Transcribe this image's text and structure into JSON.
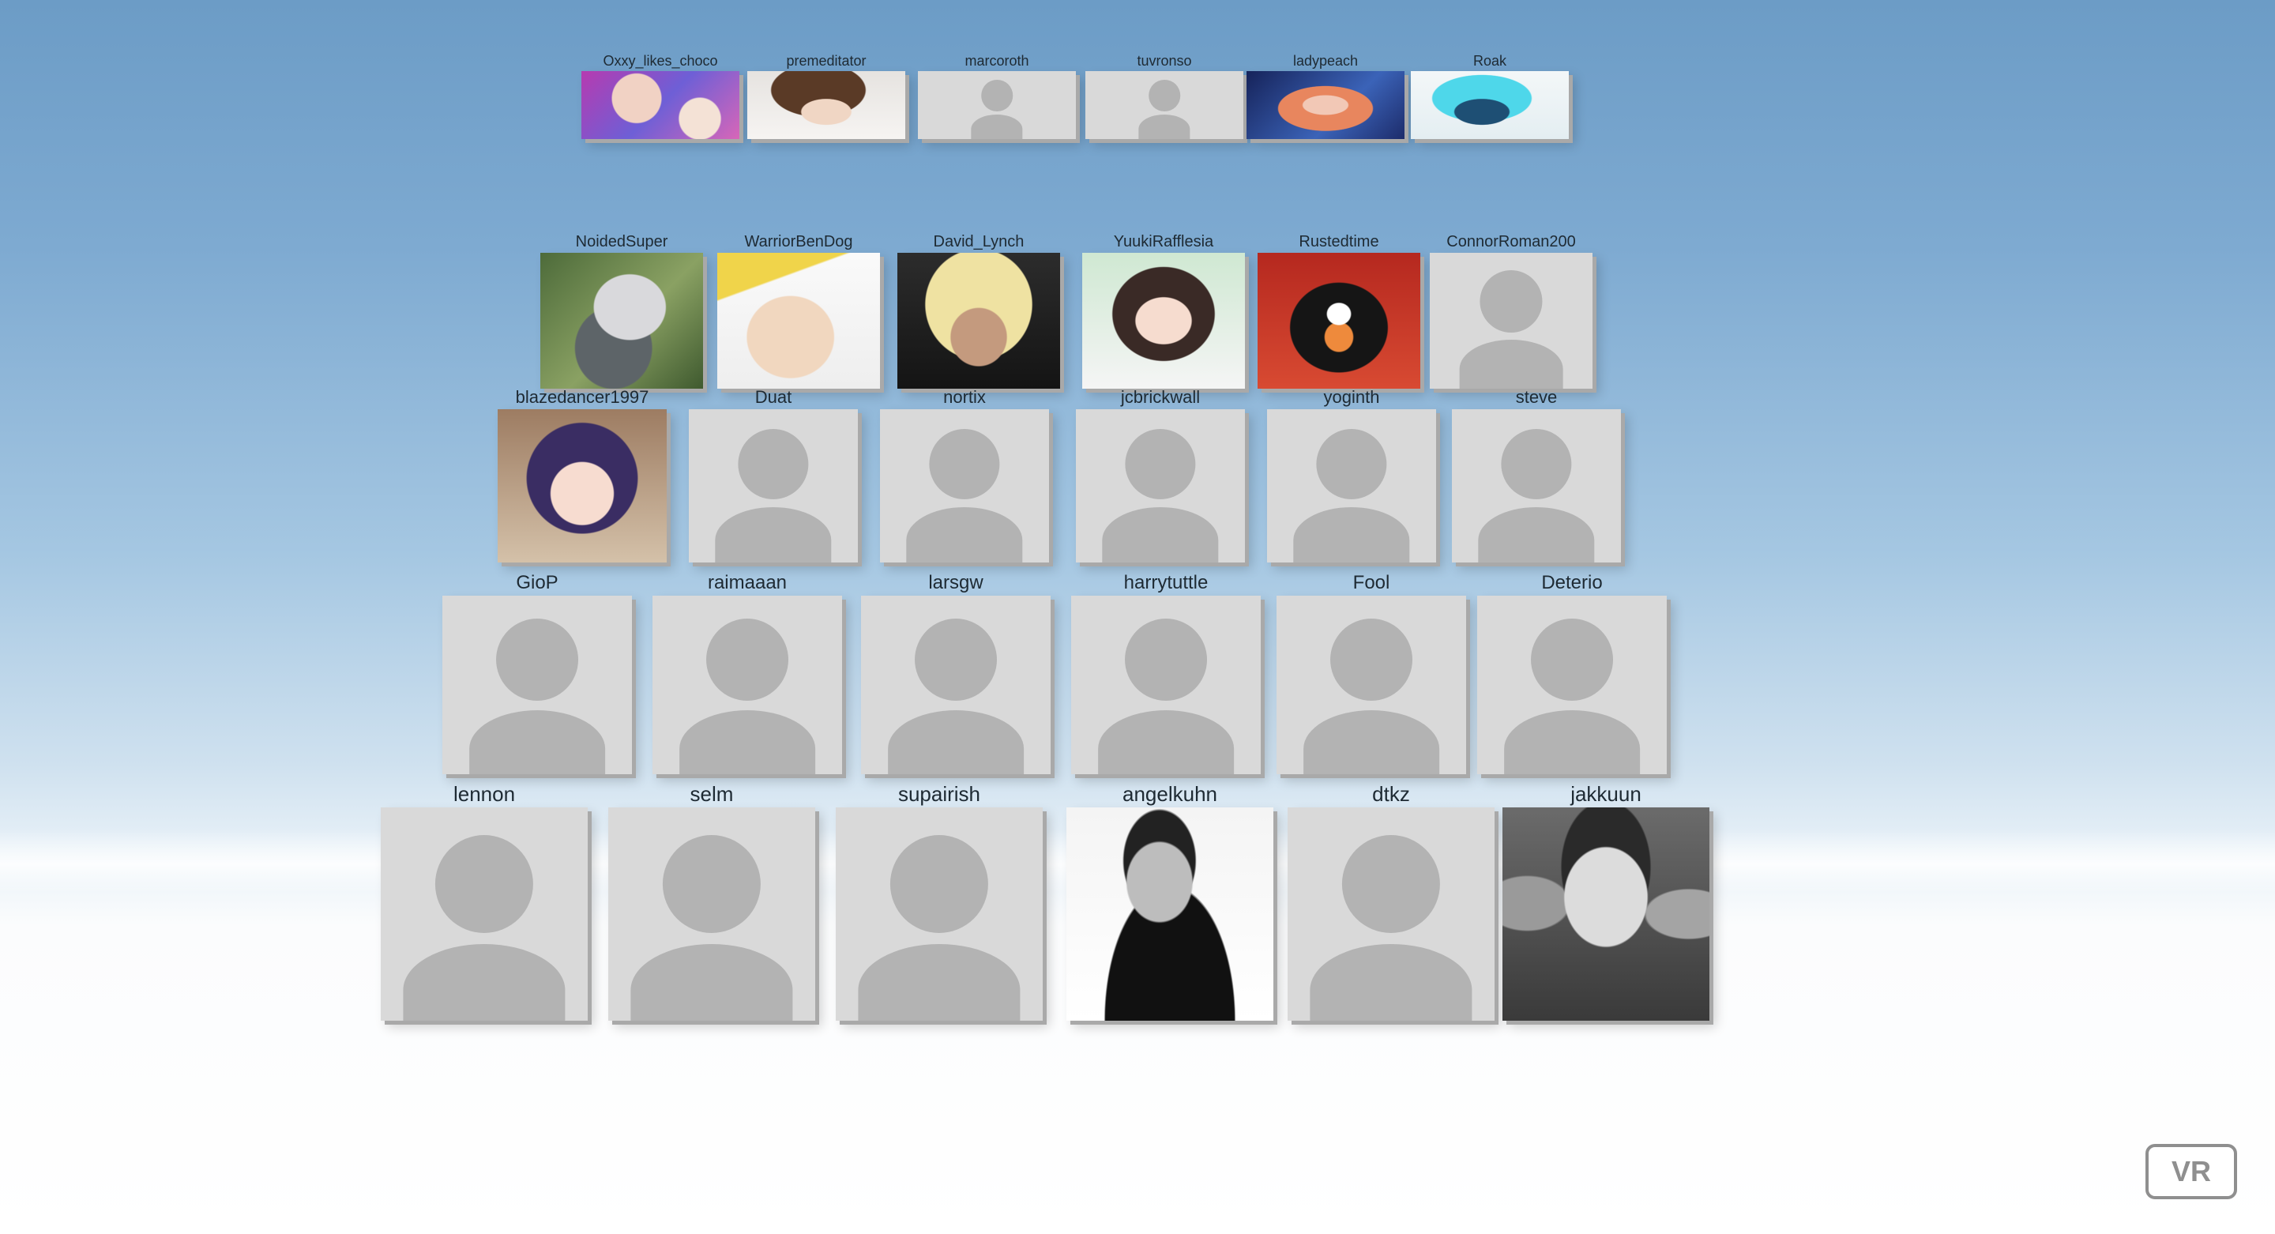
{
  "scene": {
    "sky_top": "#6c9cc6",
    "floor": "#ffffff",
    "tile_color": "#d9d9d9",
    "placeholder_color": "#b3b3b3"
  },
  "rows": [
    {
      "users": [
        {
          "name": "Oxxy_likes_choco",
          "avatar": "anime-boy-with-cat-image"
        },
        {
          "name": "premeditator",
          "avatar": "anime-boy-brown-hair-image"
        },
        {
          "name": "marcoroth",
          "avatar": "default-user-icon"
        },
        {
          "name": "tuvronso",
          "avatar": "default-user-icon"
        },
        {
          "name": "ladypeach",
          "avatar": "anime-girl-space-image"
        },
        {
          "name": "Roak",
          "avatar": "anime-girl-blue-sketch-image"
        }
      ]
    },
    {
      "users": [
        {
          "name": "NoidedSuper",
          "avatar": "harpy-eagle-photo"
        },
        {
          "name": "WarriorBenDog",
          "avatar": "chad-meme-drawing"
        },
        {
          "name": "David_Lynch",
          "avatar": "blonde-man-eyepatch-image"
        },
        {
          "name": "YuukiRafflesia",
          "avatar": "anime-girl-dark-hair-image"
        },
        {
          "name": "Rustedtime",
          "avatar": "angry-penguin-image"
        },
        {
          "name": "ConnorRoman200",
          "avatar": "default-user-icon"
        }
      ]
    },
    {
      "users": [
        {
          "name": "blazedancer1997",
          "avatar": "anime-girl-purple-hair-image"
        },
        {
          "name": "Duat",
          "avatar": "default-user-icon"
        },
        {
          "name": "nortix",
          "avatar": "default-user-icon"
        },
        {
          "name": "jcbrickwall",
          "avatar": "default-user-icon"
        },
        {
          "name": "yoginth",
          "avatar": "default-user-icon"
        },
        {
          "name": "steve",
          "avatar": "default-user-icon"
        }
      ]
    },
    {
      "users": [
        {
          "name": "GioP",
          "avatar": "default-user-icon"
        },
        {
          "name": "raimaaan",
          "avatar": "default-user-icon"
        },
        {
          "name": "larsgw",
          "avatar": "default-user-icon"
        },
        {
          "name": "harrytuttle",
          "avatar": "default-user-icon"
        },
        {
          "name": "Fool",
          "avatar": "default-user-icon"
        },
        {
          "name": "Deterio",
          "avatar": "default-user-icon"
        }
      ]
    },
    {
      "users": [
        {
          "name": "lennon",
          "avatar": "default-user-icon"
        },
        {
          "name": "selm",
          "avatar": "default-user-icon"
        },
        {
          "name": "supairish",
          "avatar": "default-user-icon"
        },
        {
          "name": "angelkuhn",
          "avatar": "man-black-tshirt-photo"
        },
        {
          "name": "dtkz",
          "avatar": "default-user-icon"
        },
        {
          "name": "jakkuun",
          "avatar": "man-kissed-bw-photo"
        }
      ]
    }
  ],
  "vr_button": {
    "label": "VR"
  }
}
